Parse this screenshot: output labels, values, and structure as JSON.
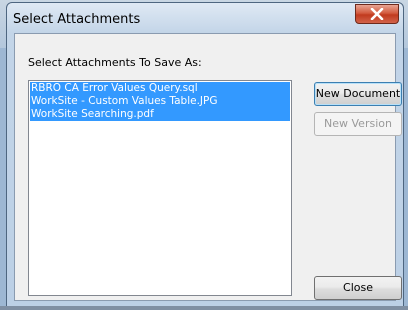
{
  "dialog": {
    "title": "Select Attachments",
    "close_icon": "close-icon"
  },
  "prompt": "Select Attachments To Save As:",
  "attachments": [
    "RBRO CA Error Values Query.sql",
    "WorkSite - Custom Values Table.JPG",
    "WorkSite Searching.pdf"
  ],
  "buttons": {
    "new_document": "New Document",
    "new_version": "New Version",
    "close": "Close"
  },
  "colors": {
    "selection": "#3399ff",
    "title_close": "#c13a1e"
  }
}
